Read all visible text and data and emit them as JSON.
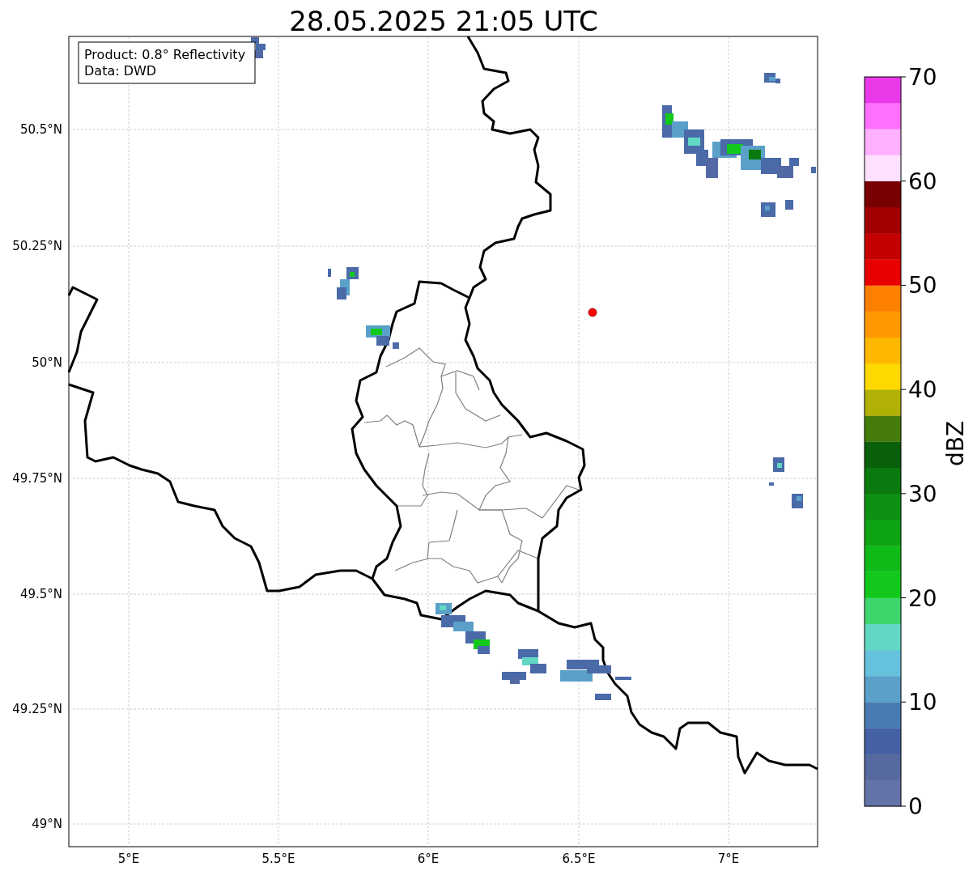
{
  "title": "28.05.2025 21:05 UTC",
  "legend": {
    "lines": [
      "Product: 0.8° Reflectivity",
      "Data: DWD"
    ]
  },
  "map": {
    "lat_labels": [
      "50.5°N",
      "50.25°N",
      "50°N",
      "49.75°N",
      "49.5°N",
      "49.25°N",
      "49°N"
    ],
    "lon_labels": [
      "5°E",
      "5.5°E",
      "6°E",
      "6.5°E",
      "7°E"
    ]
  },
  "colorbar": {
    "label": "dBZ",
    "bins": [
      {
        "color": "#6474a8"
      },
      {
        "color": "#566aa0"
      },
      {
        "color": "#4561a5"
      },
      {
        "color": "#4a7ab3"
      },
      {
        "color": "#5aa0c8"
      },
      {
        "color": "#66c2dc"
      },
      {
        "color": "#62d8c4"
      },
      {
        "color": "#3cd66c"
      },
      {
        "color": "#12c81a"
      },
      {
        "color": "#10bb18"
      },
      {
        "color": "#0ea414"
      },
      {
        "color": "#0d8f12"
      },
      {
        "color": "#0a7a0e"
      },
      {
        "color": "#0a5f0a"
      },
      {
        "color": "#457b0a"
      },
      {
        "color": "#b0b005"
      },
      {
        "color": "#ffd800"
      },
      {
        "color": "#ffb800"
      },
      {
        "color": "#ff9800"
      },
      {
        "color": "#ff7f00"
      },
      {
        "color": "#e80000"
      },
      {
        "color": "#c40000"
      },
      {
        "color": "#a00000"
      },
      {
        "color": "#780000"
      },
      {
        "color": "#ffe0ff"
      },
      {
        "color": "#ffb0ff"
      },
      {
        "color": "#ff70ff"
      },
      {
        "color": "#e838e8"
      }
    ],
    "ticks": [
      "70",
      "60",
      "50",
      "40",
      "30",
      "20",
      "10",
      "0"
    ]
  }
}
